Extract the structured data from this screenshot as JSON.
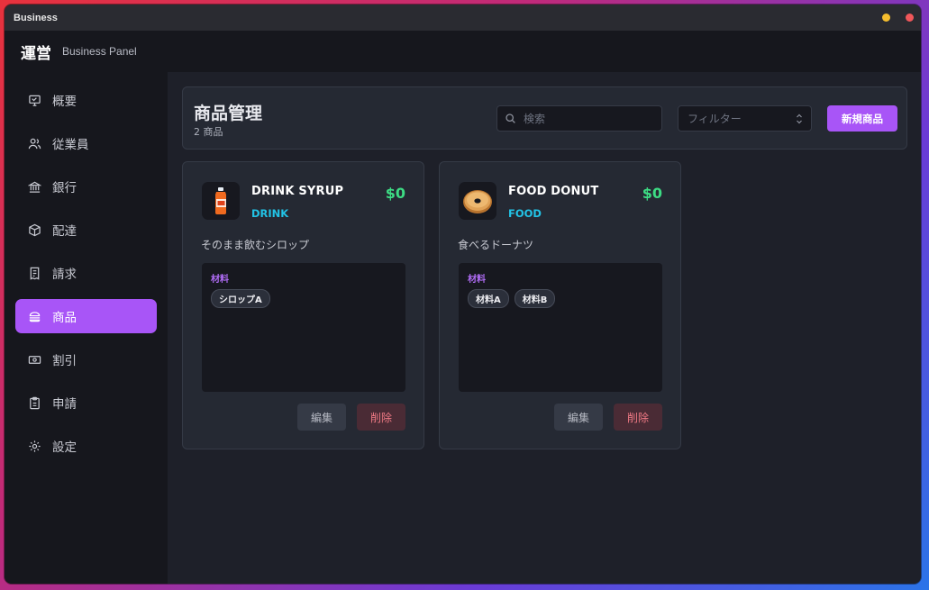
{
  "window": {
    "title": "Business"
  },
  "app": {
    "brand": "運営",
    "subtitle": "Business Panel"
  },
  "sidebar": {
    "items": [
      {
        "label": "概要",
        "icon": "monitor-icon",
        "active": false
      },
      {
        "label": "従業員",
        "icon": "users-icon",
        "active": false
      },
      {
        "label": "銀行",
        "icon": "bank-icon",
        "active": false
      },
      {
        "label": "配達",
        "icon": "package-icon",
        "active": false
      },
      {
        "label": "請求",
        "icon": "receipt-icon",
        "active": false
      },
      {
        "label": "商品",
        "icon": "burger-icon",
        "active": true
      },
      {
        "label": "割引",
        "icon": "ticket-icon",
        "active": false
      },
      {
        "label": "申請",
        "icon": "clipboard-icon",
        "active": false
      },
      {
        "label": "設定",
        "icon": "gear-icon",
        "active": false
      }
    ]
  },
  "header": {
    "title": "商品管理",
    "count": "2 商品",
    "search_placeholder": "検索",
    "filter_placeholder": "フィルター",
    "new_button": "新規商品"
  },
  "products": [
    {
      "name": "DRINK SYRUP",
      "category": "DRINK",
      "price": "$0",
      "description": "そのまま飲むシロップ",
      "materials_label": "材料",
      "materials": [
        "シロップA"
      ],
      "edit_label": "編集",
      "delete_label": "削除",
      "image_icon": "syrup-bottle-icon"
    },
    {
      "name": "FOOD DONUT",
      "category": "FOOD",
      "price": "$0",
      "description": "食べるドーナツ",
      "materials_label": "材料",
      "materials": [
        "材料A",
        "材料B"
      ],
      "edit_label": "編集",
      "delete_label": "削除",
      "image_icon": "donut-icon"
    }
  ],
  "colors": {
    "accent": "#a855f7",
    "price": "#3ddc84",
    "category": "#22c3e6",
    "danger_text": "#f07a85"
  }
}
